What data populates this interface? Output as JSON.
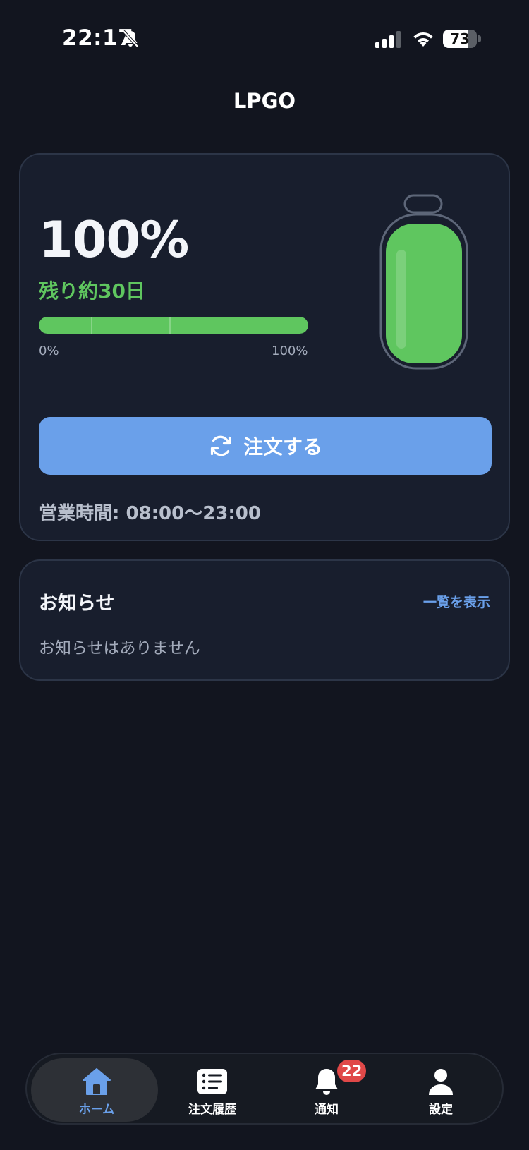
{
  "status_bar": {
    "time": "22:17",
    "battery_level": "73",
    "battery_fraction": 0.73,
    "icons": [
      "bell-slash-icon",
      "cellular-signal-icon",
      "wifi-icon",
      "battery-icon"
    ]
  },
  "header": {
    "title": "LPGO"
  },
  "gas_card": {
    "percent_text": "100%",
    "fill_fraction": 1.0,
    "remaining_text": "残り約30日",
    "gauge_min": "0%",
    "gauge_max": "100%",
    "order_button_label": "注文する",
    "order_button_icon": "refresh-icon",
    "business_hours": "営業時間: 08:00〜23:00",
    "colors": {
      "fill": "#5fc65f",
      "button": "#6aa0ea"
    }
  },
  "news": {
    "title": "お知らせ",
    "view_all_label": "一覧を表示",
    "empty_message": "お知らせはありません"
  },
  "tab_bar": {
    "tabs": [
      {
        "label": "ホーム",
        "icon": "home-icon",
        "active": true
      },
      {
        "label": "注文履歴",
        "icon": "list-icon",
        "active": false
      },
      {
        "label": "通知",
        "icon": "bell-icon",
        "active": false,
        "badge": "22"
      },
      {
        "label": "設定",
        "icon": "person-icon",
        "active": false
      }
    ]
  }
}
